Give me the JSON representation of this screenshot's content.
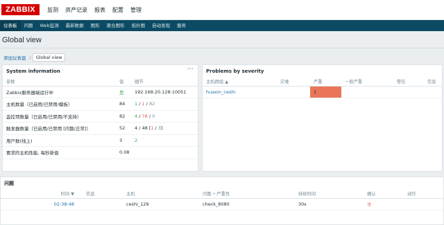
{
  "app": {
    "logo": "ZABBIX"
  },
  "main_menu": [
    "监测",
    "资产记录",
    "报表",
    "配置",
    "管理"
  ],
  "sub_menu": [
    "仪表板",
    "问题",
    "Web监测",
    "最新数据",
    "图形",
    "聚合图形",
    "拓扑图",
    "自动发现",
    "服务"
  ],
  "page": {
    "title": "Global view"
  },
  "breadcrumb": {
    "parent": "添加仪表盘",
    "separator": "/",
    "current": "Global view"
  },
  "sysinfo": {
    "title": "System information",
    "columns": {
      "param": "参数",
      "value": "值",
      "detail": "细节"
    },
    "rows": [
      {
        "param": "Zabbix服务器端运行中",
        "value": "是",
        "detail": "192.168.20.128:10051"
      },
      {
        "param": "主机数量（已启用/已禁用/模板）",
        "value": "84",
        "d1": "1",
        "s1": " / ",
        "d2": "1",
        "s2": " / ",
        "d3": "82"
      },
      {
        "param": "监控项数量（已启用/已禁用/不支持）",
        "value": "82",
        "d1": "4",
        "s1": " / ",
        "d2": "78",
        "s2": " / ",
        "d3": "0"
      },
      {
        "param": "触发器数量（已启用/已禁用 [问题/正常]）",
        "value": "52",
        "d1": "4 / 48 [",
        "s1": "1",
        "s2": " / ",
        "d2": "3",
        "d3": "]"
      },
      {
        "param": "用户数(线上)",
        "value": "3",
        "detail": "2"
      },
      {
        "param": "要求的主机性能, 每秒新值",
        "value": "0.08",
        "detail": ""
      }
    ]
  },
  "problems_severity": {
    "title": "Problems by severity",
    "columns": {
      "group": "主机群组 ▲",
      "disaster": "灾难",
      "high": "严重",
      "average": "一般严重",
      "warning": "警告",
      "info": "信息"
    },
    "rows": [
      {
        "group": "huaxin_ceshi",
        "disaster": "",
        "high": "1",
        "average": "",
        "warning": "",
        "info": ""
      }
    ],
    "colors": {
      "high": "#e97659"
    }
  },
  "issues": {
    "title": "问题",
    "columns": {
      "time": "时间 ▼",
      "info": "信息",
      "host": "主机",
      "problem": "问题 • 严重性",
      "duration": "持续时间",
      "ack": "确认",
      "actions": "动作"
    },
    "rows": [
      {
        "time": "02:38:48",
        "info": "",
        "host": "ceshi_129",
        "problem": "check_8080",
        "duration": "30s",
        "ack": "不",
        "actions": ""
      }
    ]
  }
}
